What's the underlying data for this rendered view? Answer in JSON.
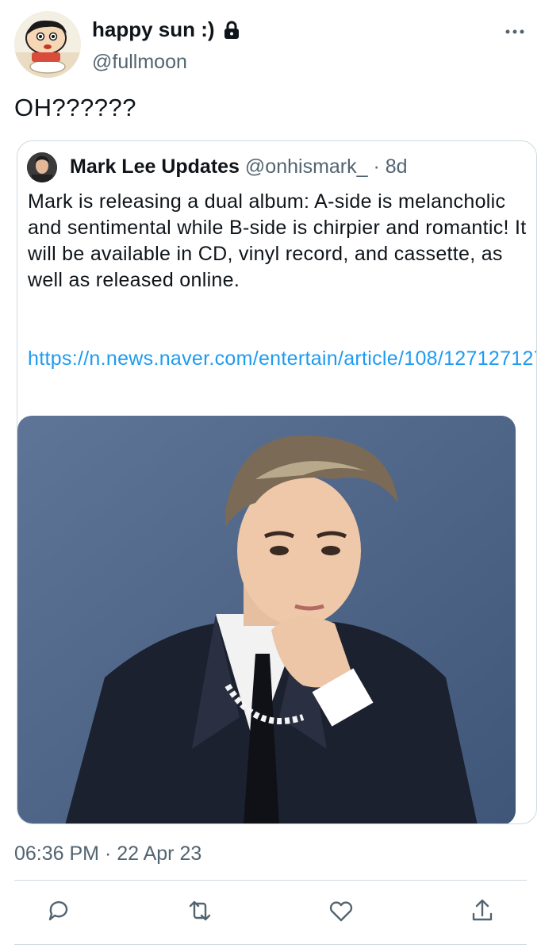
{
  "author": {
    "display_name": "happy sun :)",
    "handle": "@fullmoon",
    "avatar_icon": "cartoon-avatar",
    "protected_icon": "lock-icon"
  },
  "menu": {
    "more_icon": "more-horizontal-icon"
  },
  "tweet": {
    "text": "OH??????"
  },
  "quote": {
    "name": "Mark Lee Updates",
    "handle": "@onhismark_",
    "separator": "·",
    "age": "8d",
    "text": "Mark is releasing a dual album: A-side is melancholic and sentimental while B-side is chirpier and romantic! It will be available in CD, vinyl record, and cassette, as well as released online.",
    "link": "https://n.news.naver.com/entertain/article/108/127127127",
    "media_icon": "photo-of-person"
  },
  "timestamp": "06:36 PM · 22 Apr 23",
  "actions": [
    "reply-icon",
    "retweet-icon",
    "like-icon",
    "share-icon"
  ],
  "colors": {
    "link": "#1d9bf0",
    "secondary_text": "#536471",
    "border": "#cfd9de"
  }
}
